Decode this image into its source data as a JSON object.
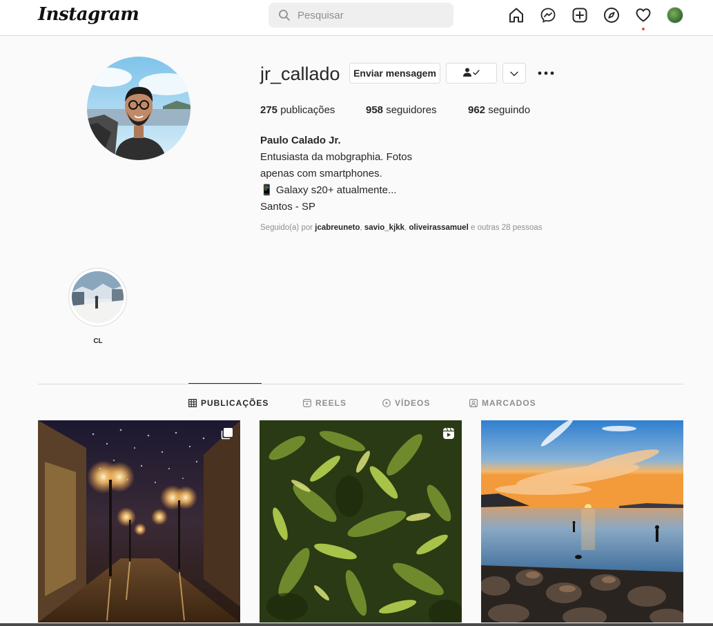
{
  "brand": {
    "logo_text": "Instagram"
  },
  "search": {
    "placeholder": "Pesquisar"
  },
  "nav": {
    "icons": [
      "home-icon",
      "messenger-icon",
      "new-post-icon",
      "explore-icon",
      "activity-heart-icon",
      "avatar"
    ],
    "notification_dot_color": "#ed4956"
  },
  "profile": {
    "username": "jr_callado",
    "message_button": "Enviar mensagem",
    "posts_count": "275",
    "posts_label": "publicações",
    "followers_count": "958",
    "followers_label": "seguidores",
    "following_count": "962",
    "following_label": "seguindo",
    "full_name": "Paulo Calado Jr.",
    "bio_lines": [
      "Entusiasta da mobgraphia. Fotos",
      "apenas com smartphones.",
      "📱 Galaxy s20+ atualmente...",
      "Santos - SP"
    ],
    "followed_by_prefix": "Seguido(a) por",
    "followed_by_users": [
      "jcabreuneto",
      "savio_kjkk",
      "oliveirassamuel"
    ],
    "followed_by_suffix": "e outras 28 pessoas"
  },
  "highlights": [
    {
      "label": "CL"
    }
  ],
  "tabs": [
    {
      "label": "PUBLICAÇÕES",
      "icon": "grid-icon",
      "active": true
    },
    {
      "label": "REELS",
      "icon": "reels-icon",
      "active": false
    },
    {
      "label": "VÍDEOS",
      "icon": "video-icon",
      "active": false
    },
    {
      "label": "MARCADOS",
      "icon": "tagged-icon",
      "active": false
    }
  ],
  "posts": [
    {
      "subject": "street-lights-night",
      "badge": "carousel-icon"
    },
    {
      "subject": "tropical-plants",
      "badge": "reel-icon"
    },
    {
      "subject": "beach-sunset",
      "badge": ""
    }
  ],
  "colors": {
    "text_primary": "#262626",
    "text_secondary": "#8e8e8e",
    "border": "#dbdbdb",
    "background": "#fafafa"
  }
}
